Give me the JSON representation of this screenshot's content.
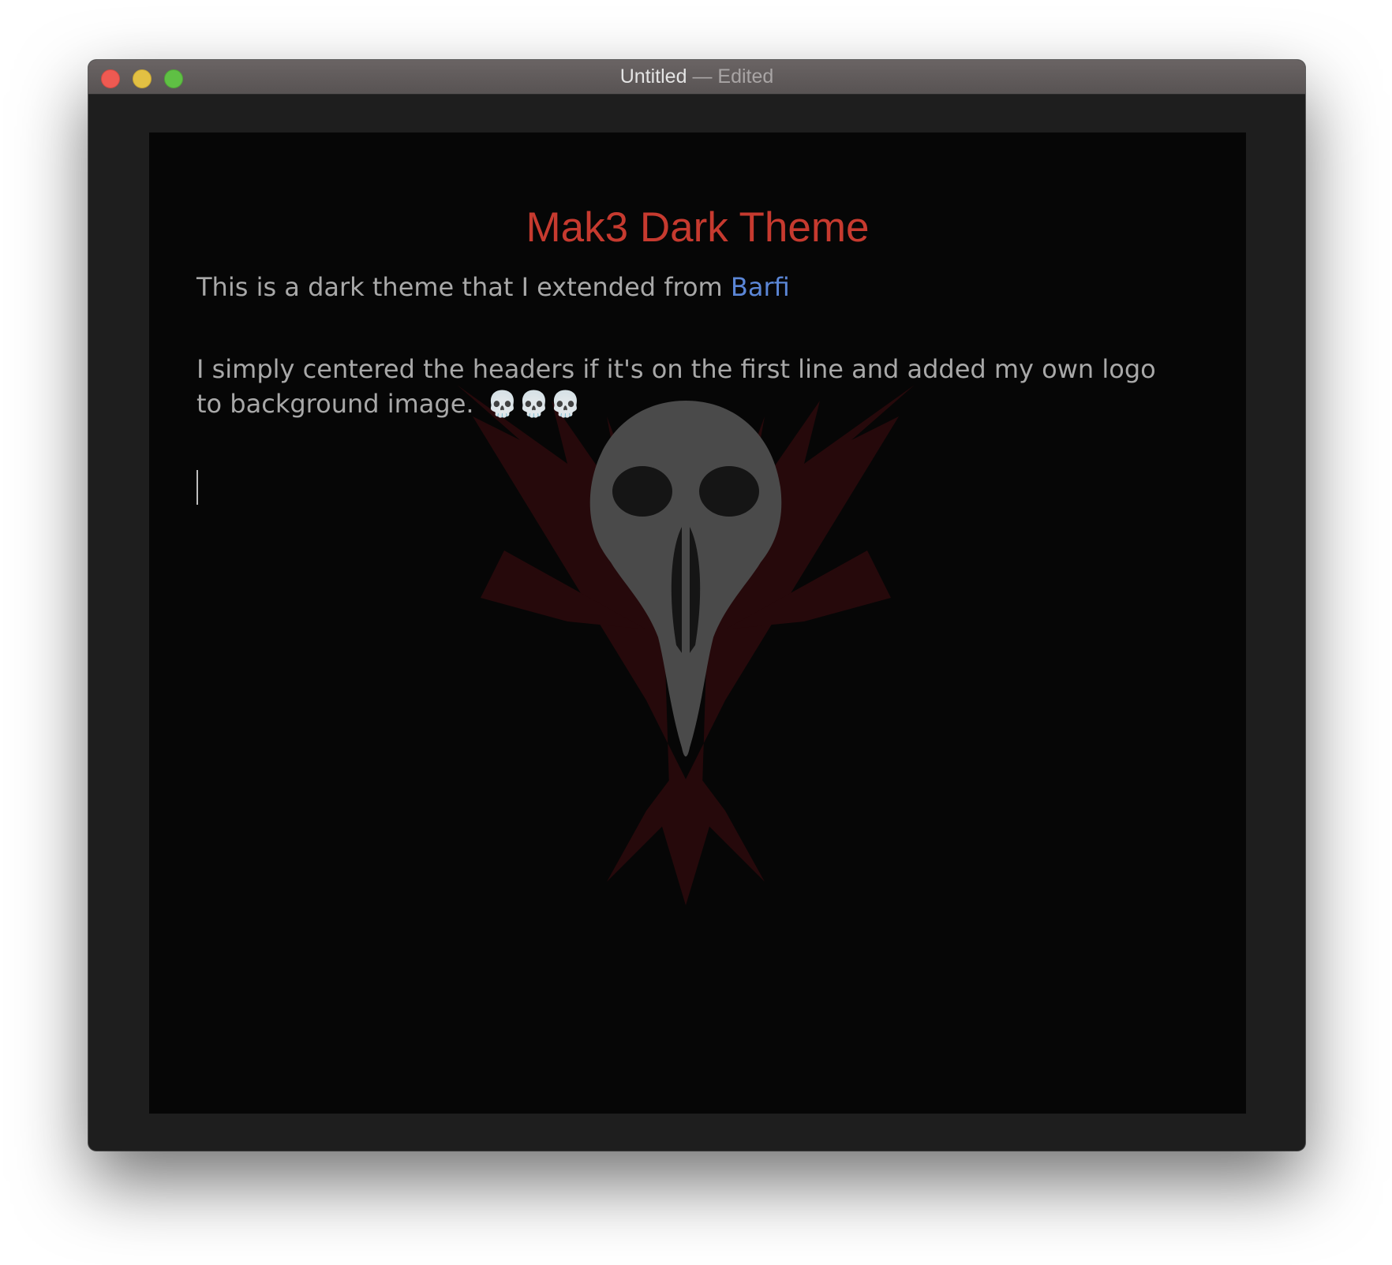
{
  "window": {
    "title": "Untitled",
    "separator": "—",
    "status": "Edited"
  },
  "traffic_lights": {
    "close": "#ee5a52",
    "minimize": "#e2c043",
    "zoom": "#5fc044"
  },
  "document": {
    "heading": "Mak3 Dark Theme",
    "paragraph1_text": "This is a dark theme that I extended from ",
    "paragraph1_link": "Barfi",
    "paragraph2_text": "I simply centered the headers if it's on the first line and added my own logo to background image.",
    "paragraph2_emoji": "💀💀💀"
  },
  "background_logo": "raven-skull-wings-icon",
  "colors": {
    "heading": "#c63a2f",
    "link": "#5b86d6",
    "body_text": "#a8a8a8",
    "editor_bg": "#060606",
    "window_bg": "#1e1e1e"
  }
}
